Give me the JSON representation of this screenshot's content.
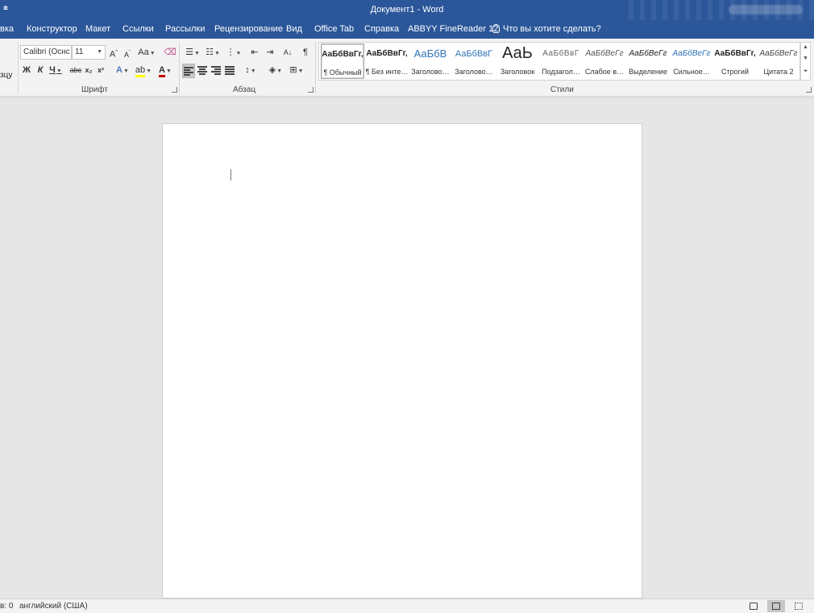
{
  "window": {
    "title": "Документ1  -  Word",
    "quick_access": "⩧"
  },
  "ribbon_tabs": [
    {
      "label": "вка"
    },
    {
      "label": "Конструктор"
    },
    {
      "label": "Макет"
    },
    {
      "label": "Ссылки"
    },
    {
      "label": "Рассылки"
    },
    {
      "label": "Рецензирование"
    },
    {
      "label": "Вид"
    },
    {
      "label": "Office Tab"
    },
    {
      "label": "Справка"
    },
    {
      "label": "ABBYY FineReader 12"
    }
  ],
  "tell_me": {
    "label": "Что вы хотите сделать?",
    "icon": "lightbulb-icon"
  },
  "clipboard": {
    "partial_label": "зцу"
  },
  "font": {
    "name": "Calibri (Оснс",
    "size": "11",
    "group_label": "Шрифт",
    "grow": "A",
    "shrink": "A",
    "change_case": "Aa",
    "bold": "Ж",
    "italic": "К",
    "underline": "Ч",
    "strikethrough": "abc",
    "subscript": "x₂",
    "superscript": "x²",
    "text_effects": "A",
    "highlight_color": "#ffff00",
    "font_color": "#c00000",
    "font_color_label": "A"
  },
  "paragraph": {
    "group_label": "Абзац",
    "pilcrow": "¶",
    "sort": "A↓"
  },
  "styles": {
    "group_label": "Стили",
    "items": [
      {
        "sample": "АаБбВвГг,",
        "name": "¶ Обычный",
        "selected": true
      },
      {
        "sample": "АаБбВвГг,",
        "name": "¶ Без инте…"
      },
      {
        "sample": "АаБбВ",
        "name": "Заголово…"
      },
      {
        "sample": "АаБбВвГ",
        "name": "Заголово…"
      },
      {
        "sample": "АаЬ",
        "name": "Заголовок"
      },
      {
        "sample": "АаБбВвГ",
        "name": "Подзагол…"
      },
      {
        "sample": "АаБбВеГг",
        "name": "Слабое в…"
      },
      {
        "sample": "АаБбВеГг",
        "name": "Выделение"
      },
      {
        "sample": "АаБбВеГг",
        "name": "Сильное…"
      },
      {
        "sample": "АаБбВвГг,",
        "name": "Строгий"
      },
      {
        "sample": "АаБбВеГг",
        "name": "Цитата 2"
      }
    ]
  },
  "status": {
    "word_count": "в: 0",
    "language": "английский (США)"
  },
  "colors": {
    "title_bar": "#2b579a",
    "ribbon": "#f3f3f3",
    "canvas": "#e6e6e6",
    "heading_blue": "#2e74b5"
  }
}
